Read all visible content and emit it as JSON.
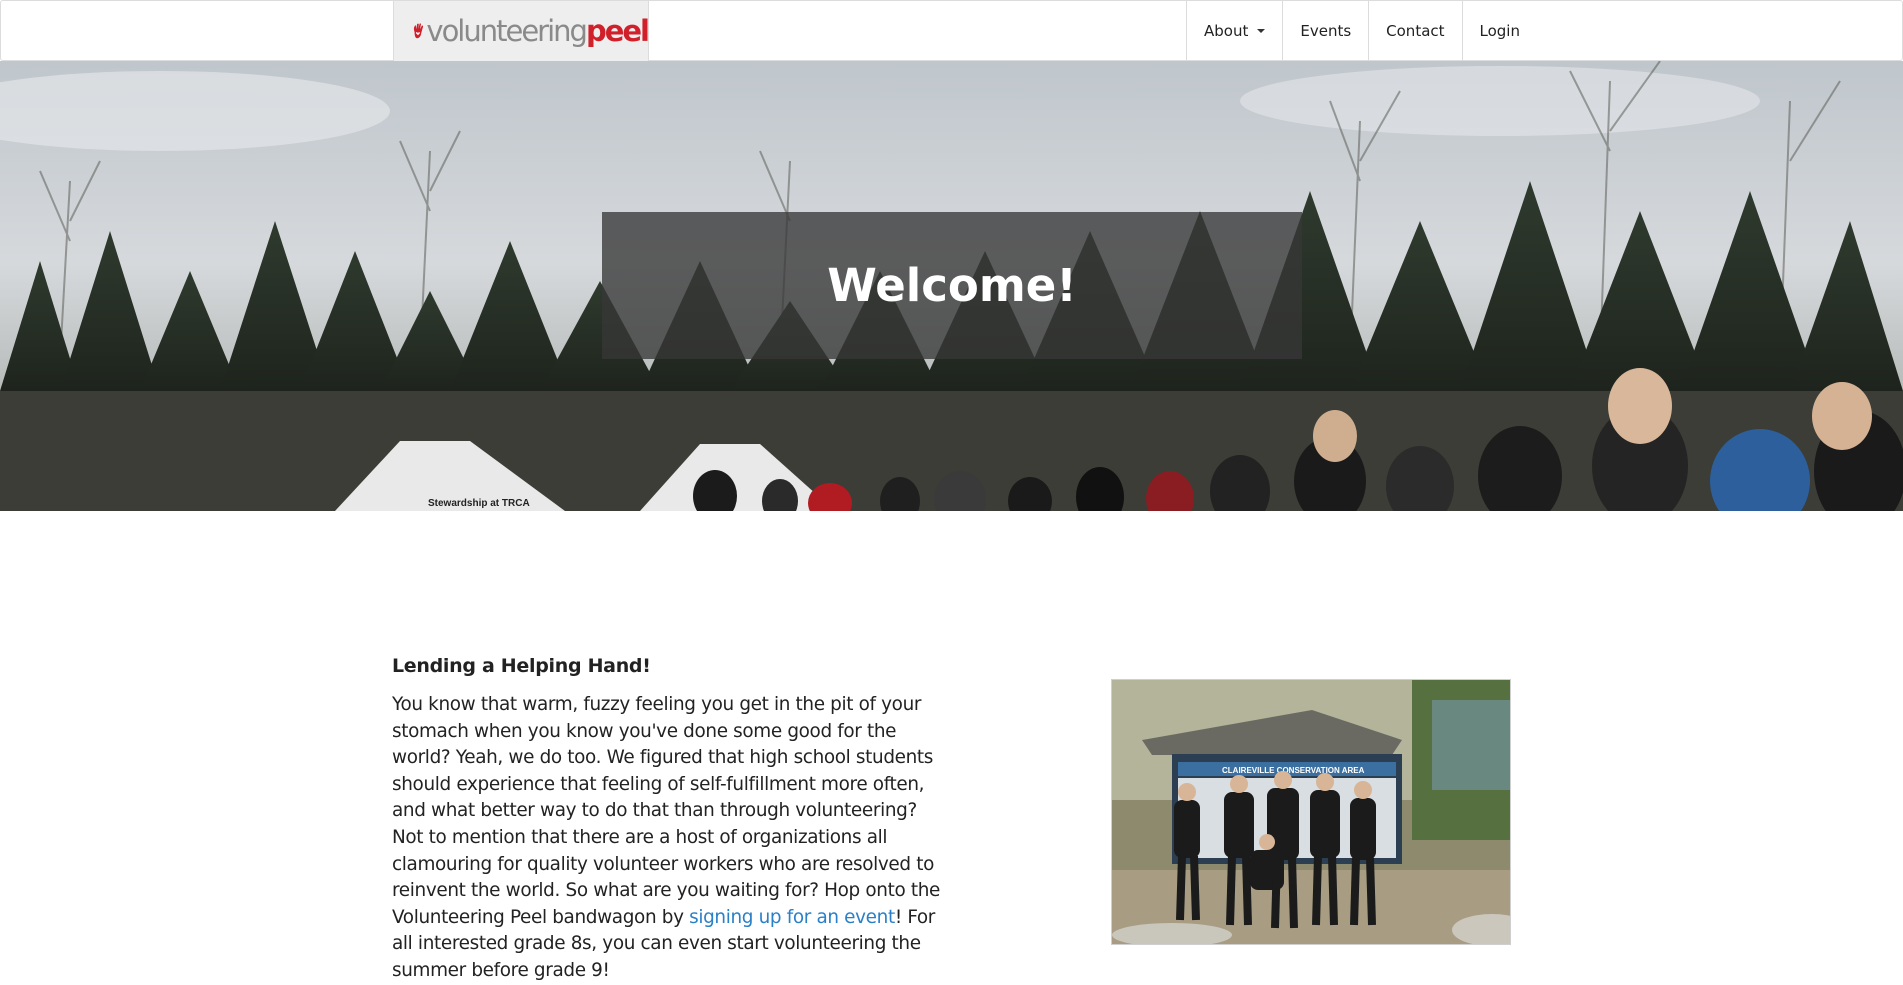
{
  "brand": {
    "part1": "volunteering",
    "part2": "peel",
    "logo_icon": "hand-heart-logo-icon"
  },
  "nav": {
    "items": [
      {
        "label": "About",
        "has_dropdown": true
      },
      {
        "label": "Events"
      },
      {
        "label": "Contact"
      },
      {
        "label": "Login"
      }
    ]
  },
  "hero": {
    "heading": "Welcome!",
    "tent_sign": "Stewardship at TRCA"
  },
  "section": {
    "title": "Lending a Helping Hand!",
    "text_before_link": "You know that warm, fuzzy feeling you get in the pit of your stomach when you know you've done some good for the world? Yeah, we do too. We figured that high school students should experience that feeling of self-fulfillment more often, and what better way to do that than through volunteering? Not to mention that there are a host of organizations all clamouring for quality volunteer workers who are resolved to reinvent the world. So what are you waiting for? Hop onto the Volunteering Peel bandwagon by ",
    "link_text": "signing up for an event",
    "text_after_link": "! For all interested grade 8s, you can even start volunteering the summer before grade 9!"
  },
  "photo": {
    "sign_text": "CLAIREVILLE CONSERVATION AREA"
  },
  "colors": {
    "brand_red": "#d0202a",
    "brand_gray": "#8a8a8a",
    "link": "#2a80c8"
  }
}
